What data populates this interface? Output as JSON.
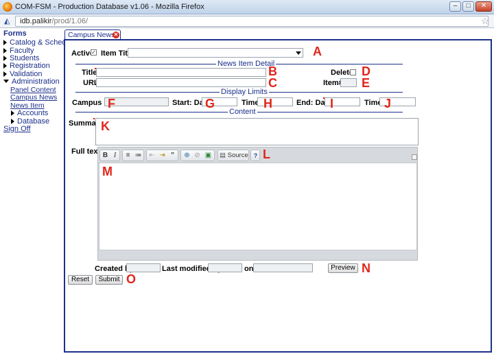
{
  "window": {
    "title": "COM-FSM - Production Database v1.06 - Mozilla Firefox",
    "url_host": "idb.palikir",
    "url_path": "/prod/1.06/"
  },
  "icons": {
    "browser": "firefox-icon",
    "site": "site-identity-icon",
    "bookmark": "star-icon",
    "tab_close": "close-icon",
    "dropdown": "chevron-down-icon",
    "nav_expand": "triangle-right-icon",
    "nav_collapse": "triangle-down-icon"
  },
  "colors": {
    "accent": "#1b2f8a",
    "annotation": "#e0261a",
    "required": "#dd0000"
  },
  "nav": {
    "heading": "Forms",
    "items": [
      {
        "label": "Catalog & Schedule"
      },
      {
        "label": "Faculty"
      },
      {
        "label": "Students"
      },
      {
        "label": "Registration"
      },
      {
        "label": "Validation"
      },
      {
        "label": "Administration"
      }
    ],
    "admin_links": [
      {
        "label": "Panel Content"
      },
      {
        "label": "Campus News"
      },
      {
        "label": "News Item"
      }
    ],
    "admin_subgroups": [
      {
        "label": "Accounts"
      },
      {
        "label": "Database"
      }
    ],
    "signoff": "Sign Off"
  },
  "tab": {
    "label": "Campus News"
  },
  "form": {
    "active_label": "Active",
    "active_checked": true,
    "item_title_label": "Item Title",
    "sections": {
      "detail": "News Item Detail",
      "limits": "Display Limits",
      "content": "Content"
    },
    "title_label": "Title",
    "delete_label": "Delete",
    "url_label": "URL",
    "item_label": "Item#",
    "campus_label": "Campus",
    "start_date_label": "Start: Date",
    "time_label": "Time",
    "end_date_label": "End: Date",
    "time2_label": "Time",
    "summary_label": "Summary",
    "fulltext_label": "Full text",
    "created_by_label": "Created by",
    "last_modified_label": "Last modified by",
    "on_label": "on",
    "preview_button": "Preview",
    "reset_button": "Reset",
    "submit_button": "Submit"
  },
  "editor_toolbar": {
    "bold": "B",
    "italic": "I",
    "quote": "”",
    "source": "Source",
    "help": "?"
  },
  "annotations": {
    "A": "A",
    "B": "B",
    "C": "C",
    "D": "D",
    "E": "E",
    "F": "F",
    "G": "G",
    "H": "H",
    "I": "I",
    "J": "J",
    "K": "K",
    "L": "L",
    "M": "M",
    "N": "N",
    "O": "O"
  }
}
